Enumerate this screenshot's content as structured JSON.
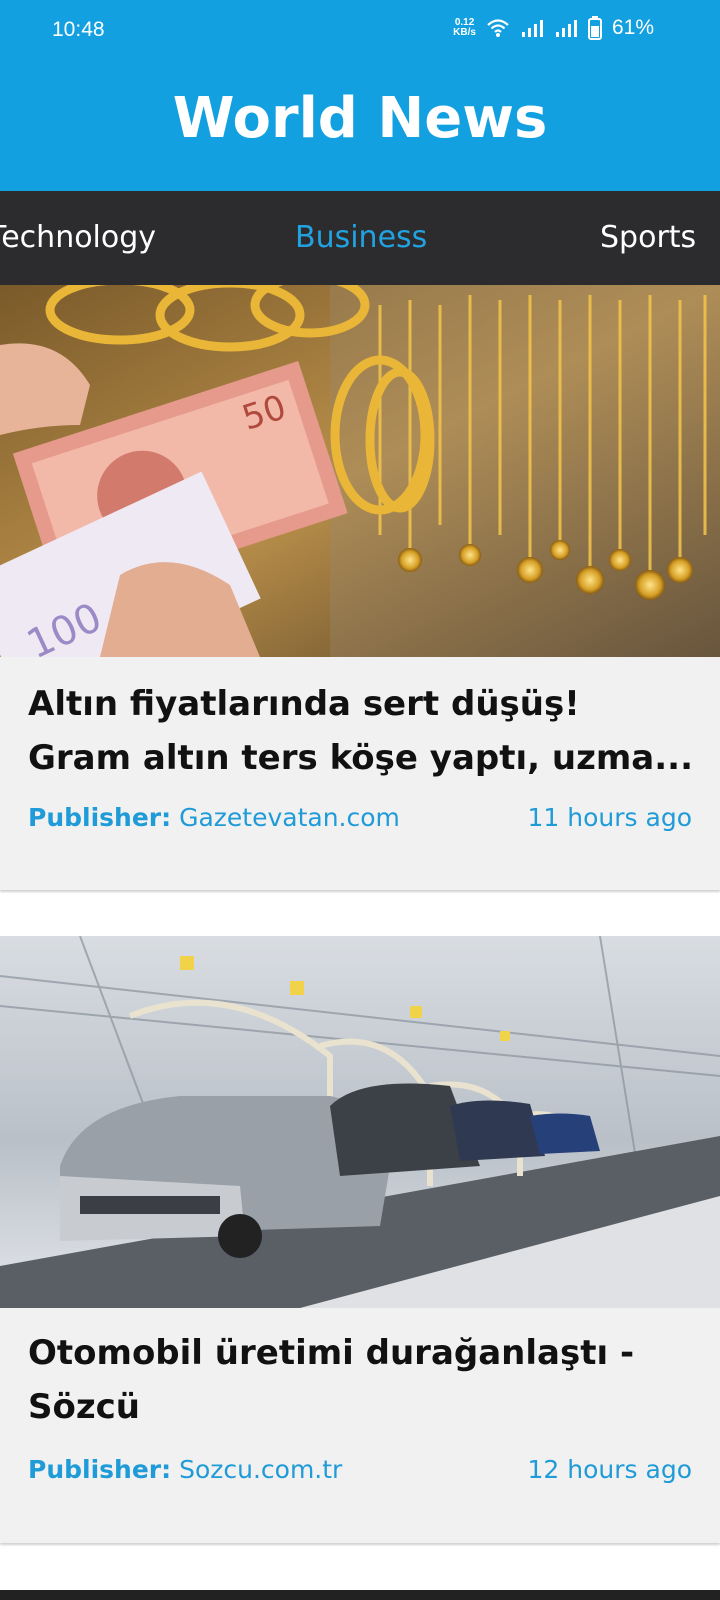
{
  "status": {
    "time": "10:48",
    "net_speed_value": "0.12",
    "net_speed_unit": "KB/s",
    "battery": "61%",
    "icons": [
      "wifi-icon",
      "signal-icon",
      "signal-icon",
      "battery-icon"
    ]
  },
  "app": {
    "title": "World News"
  },
  "tabs": [
    {
      "label": "Technology",
      "active": false
    },
    {
      "label": "Business",
      "active": true
    },
    {
      "label": "Sports",
      "active": false
    }
  ],
  "articles": [
    {
      "title_line1": "Altın fiyatlarında sert düşüş!",
      "title_line2": "Gram altın ters köşe yaptı, uzma...",
      "publisher_label": "Publisher:",
      "publisher": "Gazetevatan.com",
      "time": "11 hours ago"
    },
    {
      "title_line1": "Otomobil üretimi durağanlaştı -",
      "title_line2": "Sözcü",
      "publisher_label": "Publisher:",
      "publisher": "Sozcu.com.tr",
      "time": "12 hours ago"
    }
  ],
  "colors": {
    "accent": "#13a0e0",
    "tab_bar": "#2c2c2e",
    "card_bg": "#f1f1f2",
    "meta": "#1f9bd8"
  }
}
